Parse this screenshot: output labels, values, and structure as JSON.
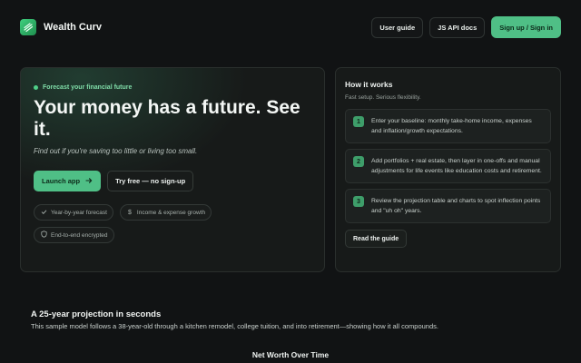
{
  "brand": {
    "name": "Wealth Curv",
    "icon": "chart-line-icon",
    "accent": "#4fbf86"
  },
  "nav": {
    "user_guide": "User guide",
    "api_docs": "JS API docs",
    "sign_in": "Sign up / Sign in"
  },
  "hero": {
    "eyebrow": "Forecast your financial future",
    "title": "Your money has a future. See it.",
    "subtitle": "Find out if you're saving too little or living too small.",
    "launch_label": "Launch app",
    "try_label": "Try free — no sign-up",
    "chips": [
      {
        "icon": "check-icon",
        "label": "Year-by-year forecast"
      },
      {
        "icon": "dollar-icon",
        "label": "Income & expense growth"
      },
      {
        "icon": "shield-icon",
        "label": "End-to-end encrypted"
      }
    ]
  },
  "how": {
    "title": "How it works",
    "subtitle": "Fast setup. Serious flexibility.",
    "steps": [
      {
        "num": "1",
        "text": "Enter your baseline: monthly take-home income, expenses and inflation/growth expectations."
      },
      {
        "num": "2",
        "text": "Add portfolios + real estate, then layer in one-offs and manual adjustments for life events like education costs and retirement."
      },
      {
        "num": "3",
        "text": "Review the projection table and charts to spot inflection points and \"uh oh\" years."
      }
    ],
    "guide_label": "Read the guide"
  },
  "projection": {
    "title": "A 25-year projection in seconds",
    "subtitle": "This sample model follows a 38-year-old through a kitchen remodel, college tuition, and into retirement—showing how it all compounds.",
    "chart_title": "Net Worth Over Time"
  }
}
